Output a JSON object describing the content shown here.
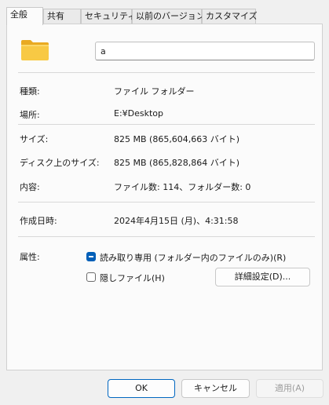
{
  "tabs": [
    "全般",
    "共有",
    "セキュリティ",
    "以前のバージョン",
    "カスタマイズ"
  ],
  "active_tab": "全般",
  "folder_icon": "folder-icon",
  "name_value": "a",
  "properties": {
    "type": {
      "label": "種類:",
      "value": "ファイル フォルダー"
    },
    "location": {
      "label": "場所:",
      "value": "E:¥Desktop"
    },
    "size": {
      "label": "サイズ:",
      "value": "825 MB (865,604,663 バイト)"
    },
    "size_on_disk": {
      "label": "ディスク上のサイズ:",
      "value": "825 MB (865,828,864 バイト)"
    },
    "contains": {
      "label": "内容:",
      "value": "ファイル数: 114、フォルダー数: 0"
    },
    "created": {
      "label": "作成日時:",
      "value": "2024年4月15日 (月)、4:31:58"
    }
  },
  "attributes": {
    "label": "属性:",
    "readonly": {
      "label": "読み取り専用 (フォルダー内のファイルのみ)(R)",
      "state": "indeterminate"
    },
    "hidden": {
      "label": "隠しファイル(H)",
      "state": "unchecked"
    },
    "advanced_button": "詳細設定(D)..."
  },
  "buttons": {
    "ok": "OK",
    "cancel": "キャンセル",
    "apply": "適用(A)"
  },
  "colors": {
    "accent": "#005fb8",
    "folder": "#f8c944",
    "folder_tab": "#e9aa22"
  }
}
